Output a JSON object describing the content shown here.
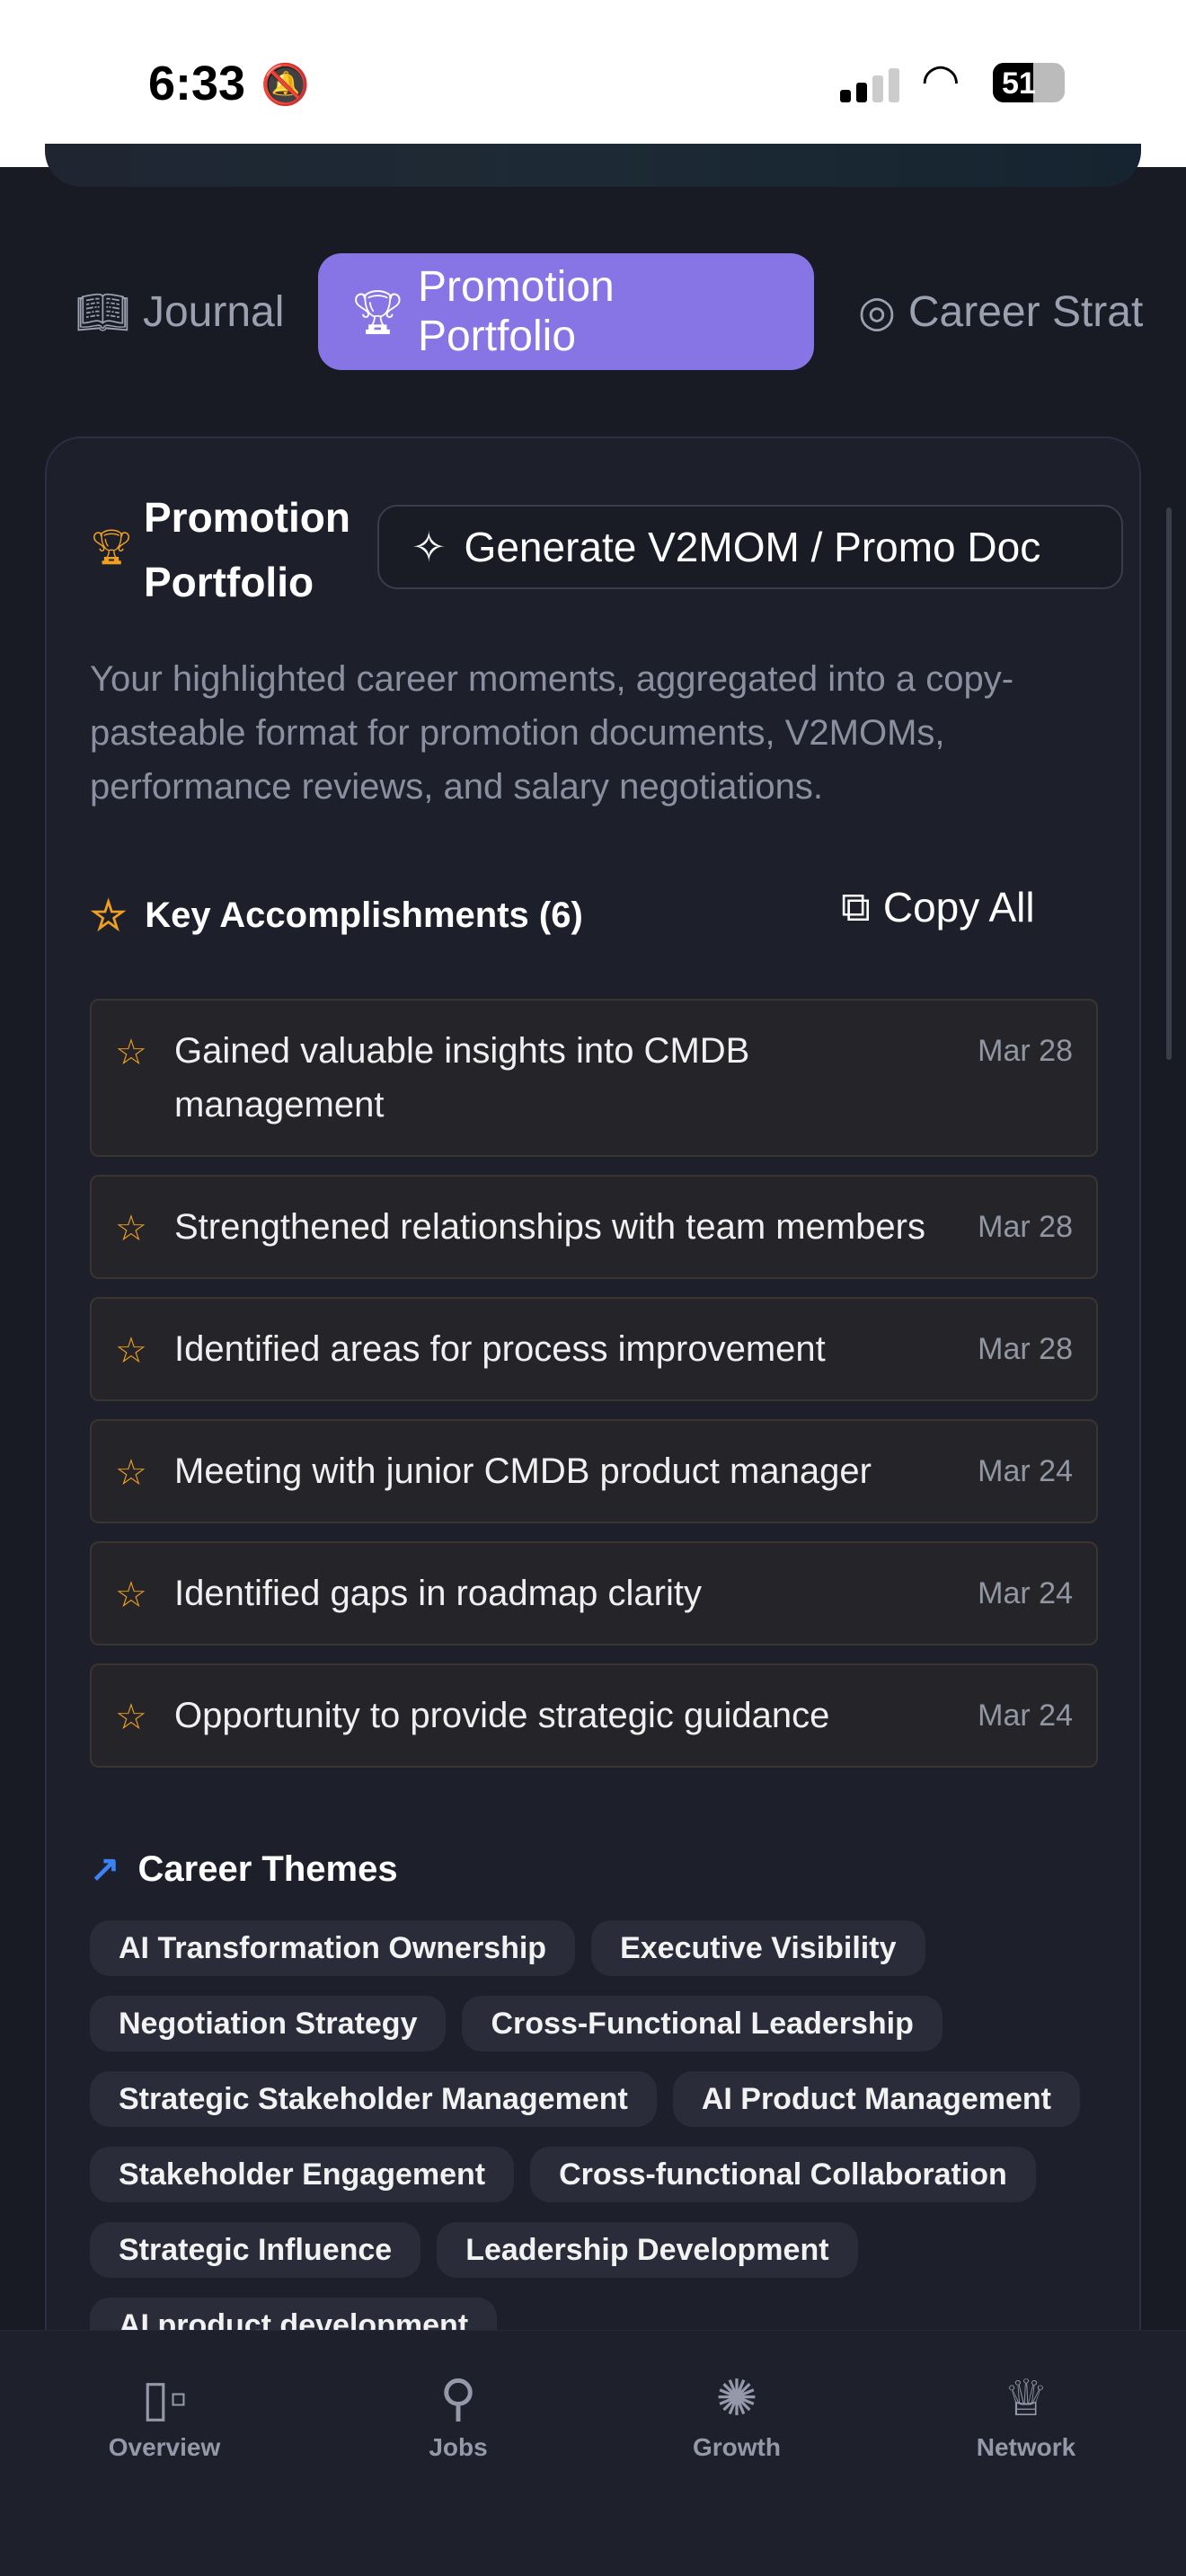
{
  "status_bar": {
    "time": "6:33",
    "battery": "51"
  },
  "tabs": [
    {
      "label": "Journal",
      "icon": "book-icon"
    },
    {
      "label": "Promotion Portfolio",
      "icon": "trophy-icon"
    },
    {
      "label": "Career Strat",
      "icon": "target-icon"
    }
  ],
  "portfolio": {
    "title": "Promotion Portfolio",
    "generate_label": "Generate V2MOM / Promo Doc",
    "description": "Your highlighted career moments, aggregated into a copy-pasteable format for promotion documents, V2MOMs, performance reviews, and salary negotiations.",
    "accomplishments_heading": "Key Accomplishments (6)",
    "copy_all_label": "Copy All",
    "accomplishments": [
      {
        "text": "Gained valuable insights into CMDB management",
        "date": "Mar 28"
      },
      {
        "text": "Strengthened relationships with team members",
        "date": "Mar 28"
      },
      {
        "text": "Identified areas for process improvement",
        "date": "Mar 28"
      },
      {
        "text": "Meeting with junior CMDB product manager",
        "date": "Mar 24"
      },
      {
        "text": "Identified gaps in roadmap clarity",
        "date": "Mar 24"
      },
      {
        "text": "Opportunity to provide strategic guidance",
        "date": "Mar 24"
      }
    ],
    "themes_heading": "Career Themes",
    "themes": [
      "AI Transformation Ownership",
      "Executive Visibility",
      "Negotiation Strategy",
      "Cross-Functional Leadership",
      "Strategic Stakeholder Management",
      "AI Product Management",
      "Stakeholder Engagement",
      "Cross-functional Collaboration",
      "Strategic Influence",
      "Leadership Development",
      "AI product development"
    ]
  },
  "bottom_nav": [
    {
      "label": "Overview"
    },
    {
      "label": "Jobs"
    },
    {
      "label": "Growth"
    },
    {
      "label": "Network"
    }
  ],
  "colors": {
    "accent": "#8775e6",
    "star": "#f0a020",
    "trend": "#3b82f6"
  }
}
